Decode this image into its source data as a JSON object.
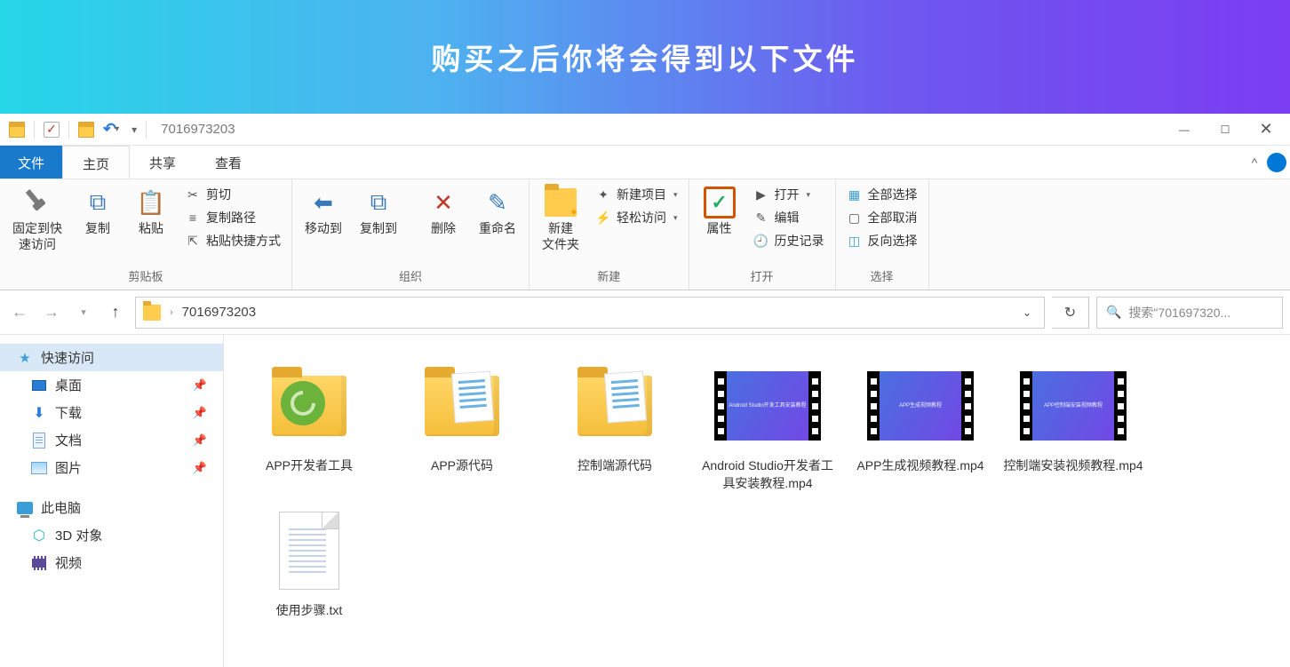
{
  "banner": {
    "title": "购买之后你将会得到以下文件"
  },
  "titlebar": {
    "title": "7016973203"
  },
  "tabs": {
    "file": "文件",
    "home": "主页",
    "share": "共享",
    "view": "查看"
  },
  "ribbon": {
    "clipboard": {
      "label": "剪贴板",
      "pin": "固定到快\n速访问",
      "copy": "复制",
      "paste": "粘贴",
      "cut": "剪切",
      "copyPath": "复制路径",
      "pasteShortcut": "粘贴快捷方式"
    },
    "organize": {
      "label": "组织",
      "moveTo": "移动到",
      "copyTo": "复制到",
      "delete": "删除",
      "rename": "重命名"
    },
    "new": {
      "label": "新建",
      "newFolder": "新建\n文件夹",
      "newItem": "新建项目",
      "easyAccess": "轻松访问"
    },
    "open": {
      "label": "打开",
      "properties": "属性",
      "open": "打开",
      "edit": "编辑",
      "history": "历史记录"
    },
    "select": {
      "label": "选择",
      "selectAll": "全部选择",
      "selectNone": "全部取消",
      "invert": "反向选择"
    }
  },
  "nav": {
    "path": "7016973203",
    "searchPlaceholder": "搜索\"701697320..."
  },
  "sidebar": {
    "quickAccess": "快速访问",
    "desktop": "桌面",
    "downloads": "下载",
    "documents": "文档",
    "pictures": "图片",
    "thisPC": "此电脑",
    "objects3d": "3D 对象",
    "videos": "视频"
  },
  "files": [
    {
      "name": "APP开发者工具",
      "type": "folder-app"
    },
    {
      "name": "APP源代码",
      "type": "folder-docs"
    },
    {
      "name": "控制端源代码",
      "type": "folder-docs"
    },
    {
      "name": "Android Studio开发者工具安装教程.mp4",
      "type": "video"
    },
    {
      "name": "APP生成视频教程.mp4",
      "type": "video"
    },
    {
      "name": "控制端安装视频教程.mp4",
      "type": "video"
    },
    {
      "name": "使用步骤.txt",
      "type": "txt"
    }
  ]
}
